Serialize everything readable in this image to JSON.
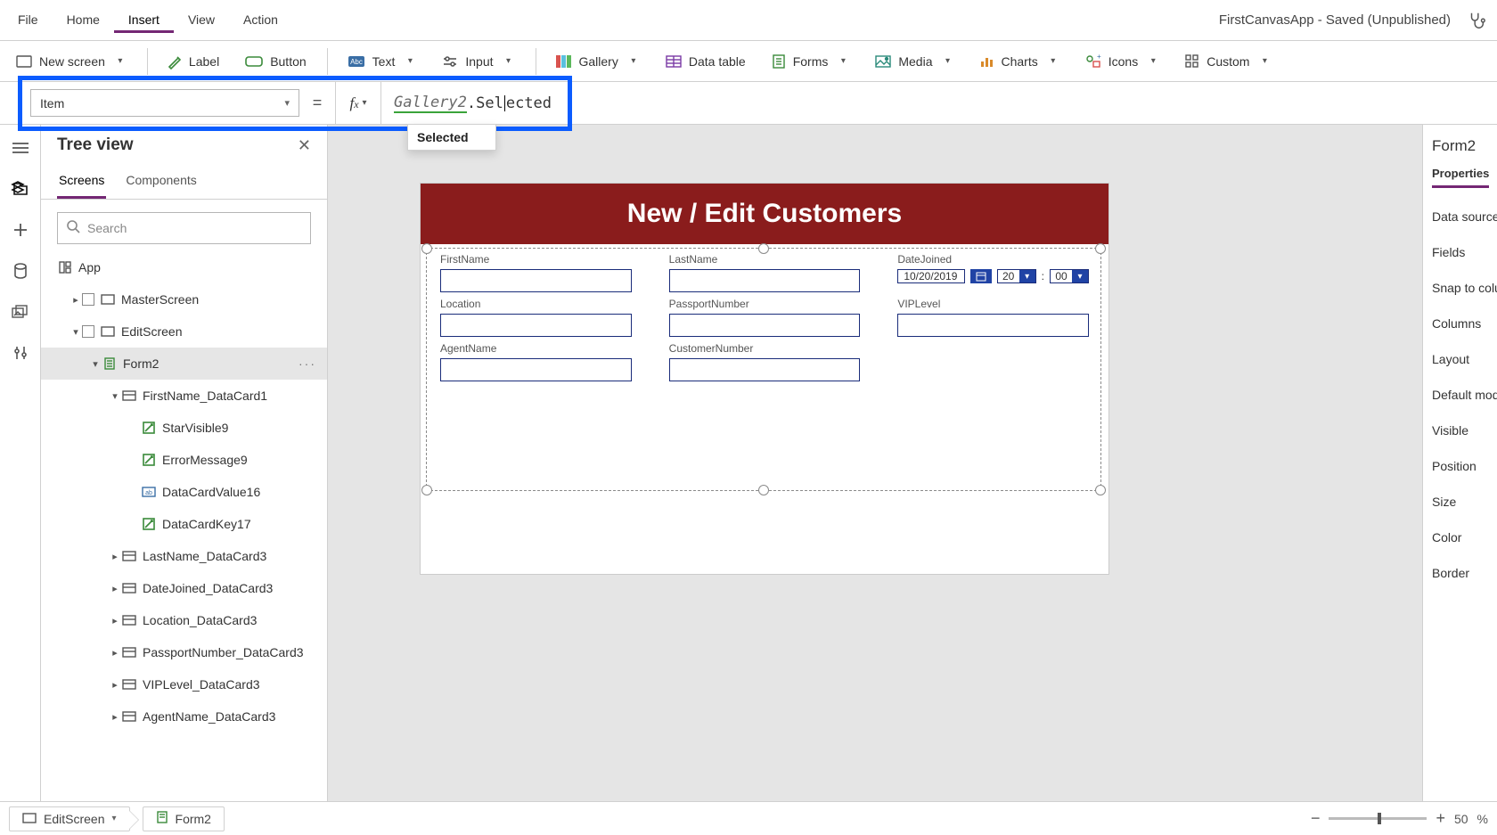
{
  "menu": {
    "file": "File",
    "home": "Home",
    "insert": "Insert",
    "view": "View",
    "action": "Action"
  },
  "appStatus": "FirstCanvasApp - Saved (Unpublished)",
  "ribbon": {
    "newScreen": "New screen",
    "label": "Label",
    "button": "Button",
    "text": "Text",
    "input": "Input",
    "gallery": "Gallery",
    "dataTable": "Data table",
    "forms": "Forms",
    "media": "Media",
    "charts": "Charts",
    "icons": "Icons",
    "custom": "Custom"
  },
  "formula": {
    "property": "Item",
    "object": "Gallery2",
    "member": ".Selected",
    "suggestion": "Selected"
  },
  "tree": {
    "title": "Tree view",
    "tabs": {
      "screens": "Screens",
      "components": "Components"
    },
    "searchPlaceholder": "Search",
    "app": "App",
    "items": [
      {
        "name": "MasterScreen",
        "depth": 0,
        "chev": ">",
        "icon": "screen"
      },
      {
        "name": "EditScreen",
        "depth": 0,
        "chev": "v",
        "icon": "screen"
      },
      {
        "name": "Form2",
        "depth": 1,
        "chev": "v",
        "icon": "form",
        "sel": true,
        "more": true
      },
      {
        "name": "FirstName_DataCard1",
        "depth": 2,
        "chev": "v",
        "icon": "card"
      },
      {
        "name": "StarVisible9",
        "depth": 3,
        "chev": "",
        "icon": "ctl"
      },
      {
        "name": "ErrorMessage9",
        "depth": 3,
        "chev": "",
        "icon": "ctl"
      },
      {
        "name": "DataCardValue16",
        "depth": 3,
        "chev": "",
        "icon": "txt"
      },
      {
        "name": "DataCardKey17",
        "depth": 3,
        "chev": "",
        "icon": "ctl"
      },
      {
        "name": "LastName_DataCard3",
        "depth": 2,
        "chev": ">",
        "icon": "card"
      },
      {
        "name": "DateJoined_DataCard3",
        "depth": 2,
        "chev": ">",
        "icon": "card"
      },
      {
        "name": "Location_DataCard3",
        "depth": 2,
        "chev": ">",
        "icon": "card"
      },
      {
        "name": "PassportNumber_DataCard3",
        "depth": 2,
        "chev": ">",
        "icon": "card"
      },
      {
        "name": "VIPLevel_DataCard3",
        "depth": 2,
        "chev": ">",
        "icon": "card"
      },
      {
        "name": "AgentName_DataCard3",
        "depth": 2,
        "chev": ">",
        "icon": "card"
      }
    ]
  },
  "canvas": {
    "headerText": "New / Edit Customers",
    "cards": [
      {
        "label": "FirstName",
        "type": "text"
      },
      {
        "label": "LastName",
        "type": "text"
      },
      {
        "label": "DateJoined",
        "type": "date",
        "date": "10/20/2019",
        "hour": "20",
        "min": "00"
      },
      {
        "label": "Location",
        "type": "text"
      },
      {
        "label": "PassportNumber",
        "type": "text"
      },
      {
        "label": "VIPLevel",
        "type": "text"
      },
      {
        "label": "AgentName",
        "type": "text"
      },
      {
        "label": "CustomerNumber",
        "type": "text"
      }
    ]
  },
  "props": {
    "title": "Form2",
    "tab": "Properties",
    "rows": [
      "Data source",
      "Fields",
      "Snap to colu",
      "Columns",
      "Layout",
      "Default mod",
      "Visible",
      "Position",
      "Size",
      "Color",
      "Border"
    ]
  },
  "status": {
    "crumb1": "EditScreen",
    "crumb2": "Form2",
    "zoom": "50",
    "zoomUnit": "%"
  }
}
